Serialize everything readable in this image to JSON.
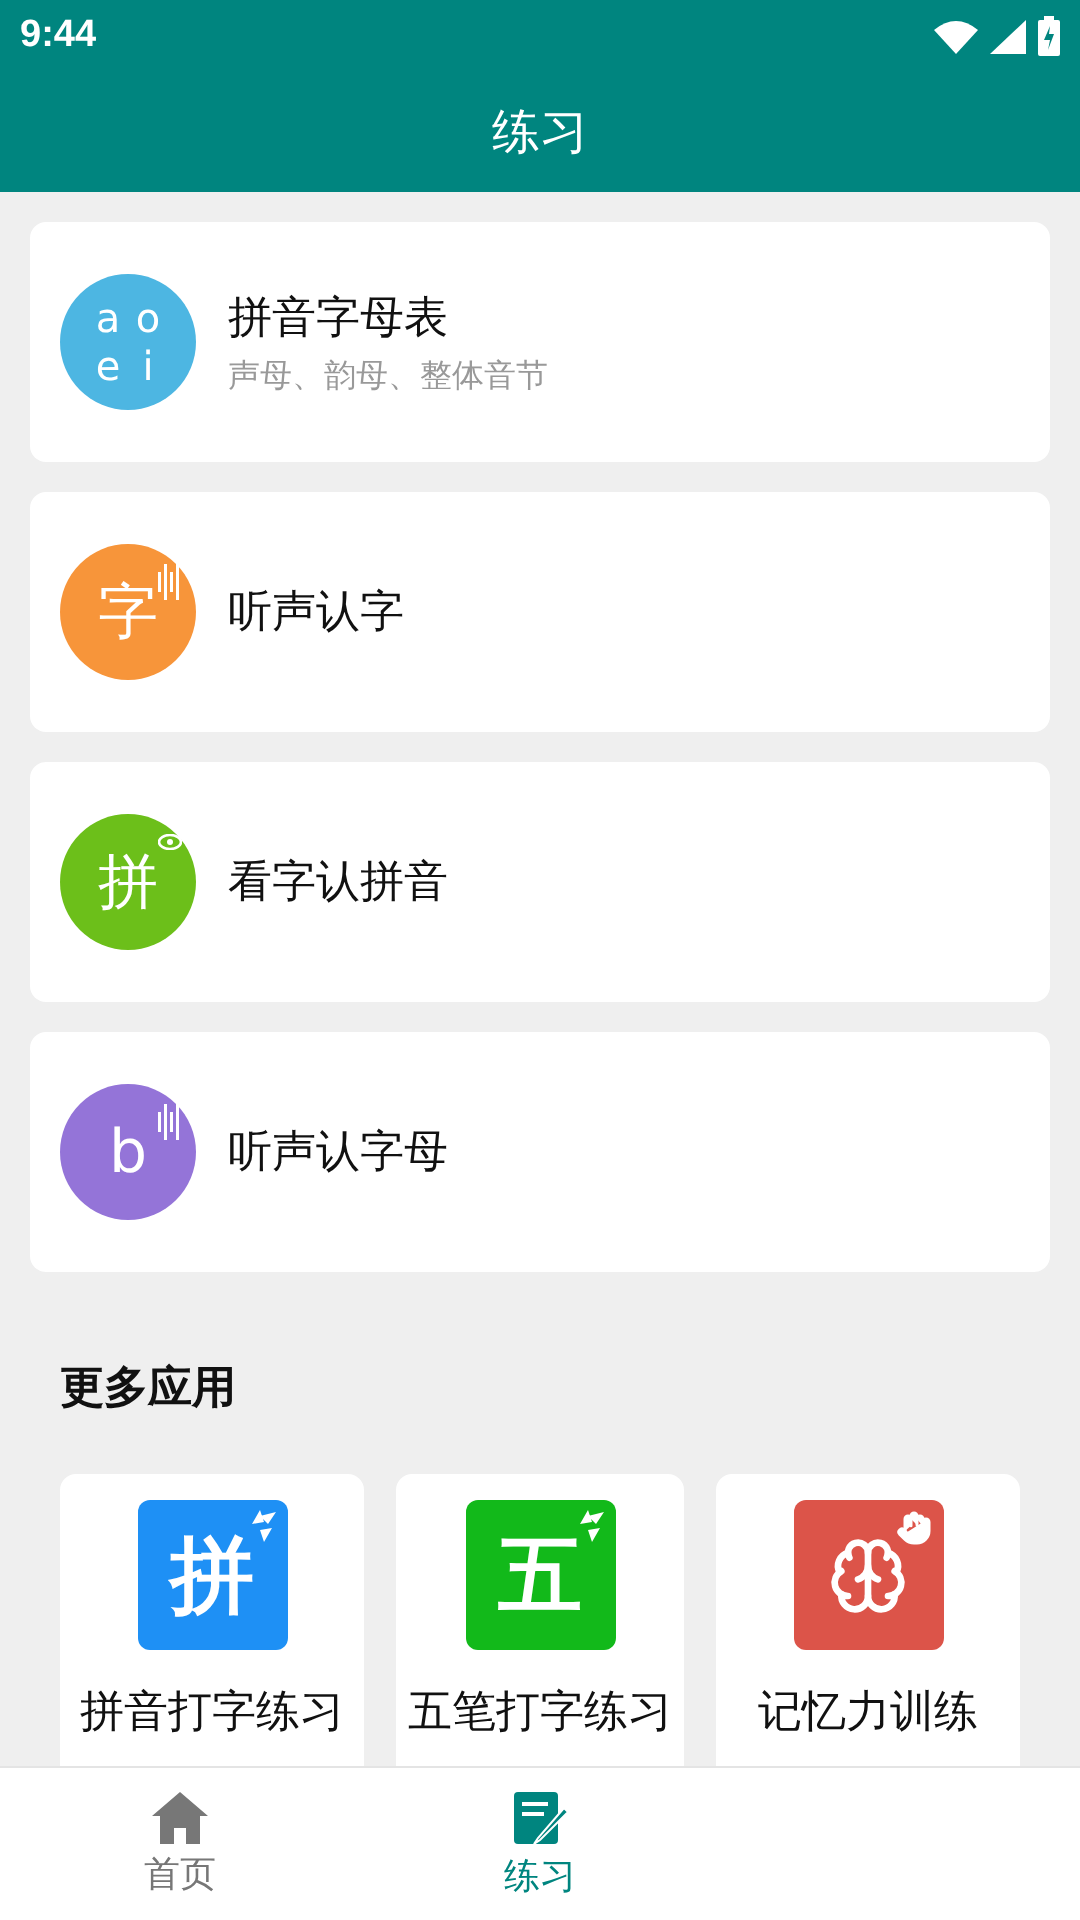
{
  "status_bar": {
    "time": "9:44"
  },
  "header": {
    "title": "练习"
  },
  "practice_items": [
    {
      "kind": "letters",
      "glyphs": [
        "a",
        "o",
        "e",
        "i"
      ],
      "color": "#4db6e2",
      "title": "拼音字母表",
      "subtitle": "声母、韵母、整体音节"
    },
    {
      "kind": "sound",
      "glyphs": [
        "字"
      ],
      "color": "#f7953a",
      "title": "听声认字"
    },
    {
      "kind": "eye",
      "glyphs": [
        "拼"
      ],
      "color": "#6cbf1a",
      "title": "看字认拼音"
    },
    {
      "kind": "sound",
      "glyphs": [
        "b"
      ],
      "color": "#9474d8",
      "title": "听声认字母"
    }
  ],
  "more_apps": {
    "title": "更多应用",
    "apps": [
      {
        "kind": "pinyin",
        "glyph": "拼",
        "color": "#1e90f5",
        "label": "拼音打字练习"
      },
      {
        "kind": "wubi",
        "glyph": "五",
        "color": "#12b91a",
        "label": "五笔打字练习"
      },
      {
        "kind": "memory",
        "color": "#dc5449",
        "label": "记忆力训练"
      }
    ]
  },
  "bottom_nav": [
    {
      "kind": "home",
      "label": "首页",
      "selected": false
    },
    {
      "kind": "practice",
      "label": "练习",
      "selected": true
    }
  ]
}
